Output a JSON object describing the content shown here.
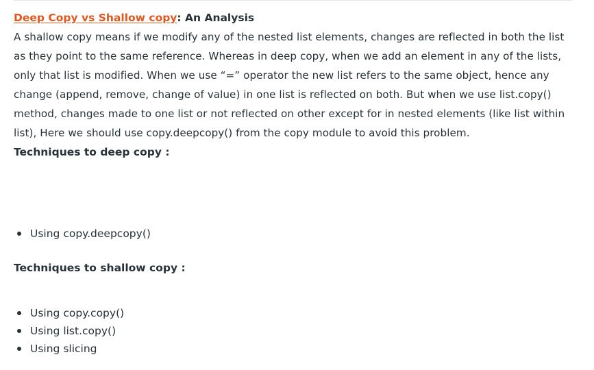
{
  "heading": {
    "link_text": "Deep Copy vs Shallow copy",
    "suffix_text": ": An Analysis"
  },
  "paragraph": "A shallow copy means if we modify any of the nested list elements, changes are reflected in both the list as they point to the same reference. Whereas in deep copy, when we add an element in any of the lists, only that list is modified. When we use “=” operator the new list refers to the same object, hence any change (append, remove, change of value) in one list is reflected on both. But when we use list.copy() method, changes made to one list or not reflected on other except for in nested elements (like list within list), Here we should use copy.deepcopy() from the copy module to avoid this problem.",
  "deep_copy": {
    "title": "Techniques to deep copy :",
    "items": [
      "Using copy.deepcopy()"
    ]
  },
  "shallow_copy": {
    "title": "Techniques to shallow copy :",
    "items": [
      "Using copy.copy()",
      "Using list.copy()",
      "Using slicing"
    ]
  }
}
